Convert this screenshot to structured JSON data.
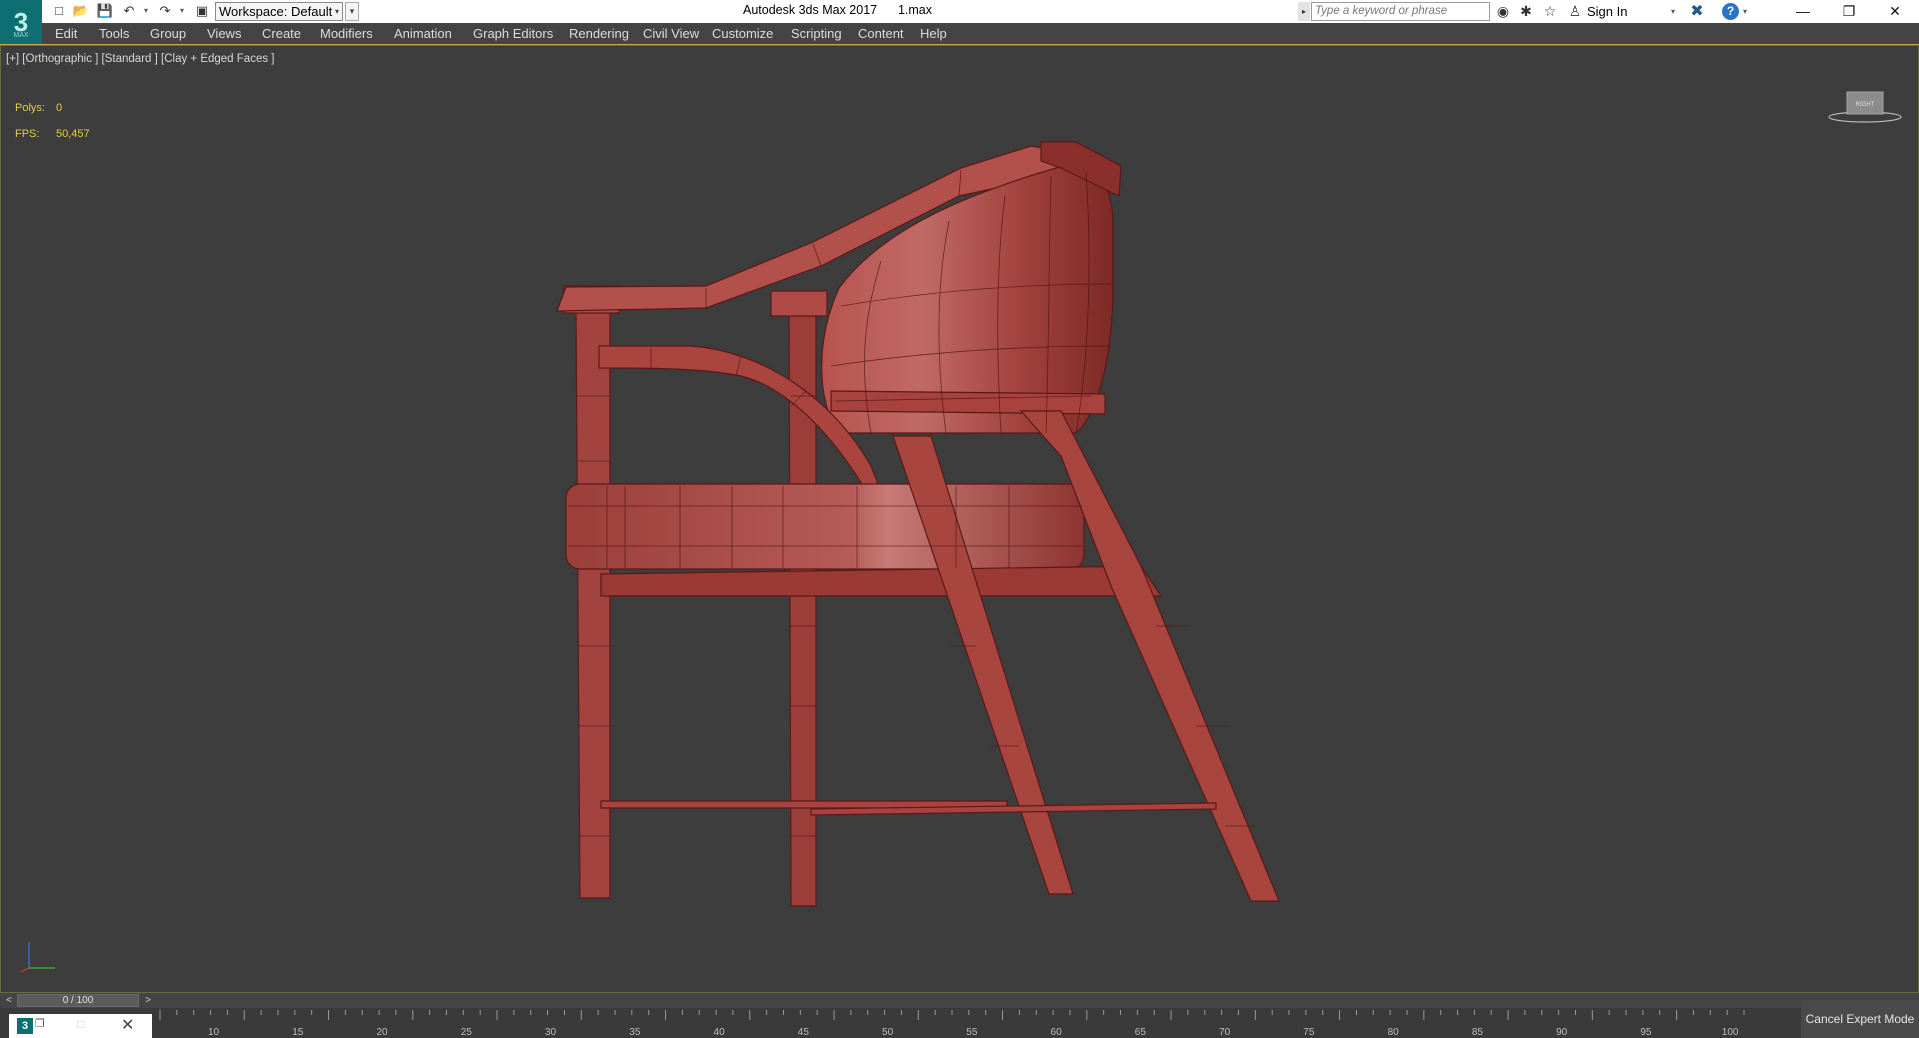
{
  "app": {
    "logo_text": "3",
    "logo_caption": "MAX",
    "window_title": "Autodesk 3ds Max 2017      1.max",
    "workspace_label": "Workspace: Default",
    "search_placeholder": "Type a keyword or phrase",
    "sign_in_label": "Sign In",
    "help_label": "?"
  },
  "menu": [
    "Edit",
    "Tools",
    "Group",
    "Views",
    "Create",
    "Modifiers",
    "Animation",
    "Graph Editors",
    "Rendering",
    "Civil View",
    "Customize",
    "Scripting",
    "Content",
    "Help"
  ],
  "viewport": {
    "label": "[+] [Orthographic ] [Standard ] [Clay + Edged Faces ]",
    "polys_label": "Polys:",
    "polys_value": "0",
    "fps_label": "FPS:",
    "fps_value": "50,457",
    "viewcube_text": "RIGHT",
    "model_color": "#a7423e"
  },
  "timeline": {
    "slider_text": "0 / 100",
    "prev_label": "<",
    "next_label": ">",
    "ticks": [
      "10",
      "15",
      "20",
      "25",
      "30",
      "35",
      "40",
      "45",
      "50",
      "55",
      "60",
      "65",
      "70",
      "75",
      "80",
      "85",
      "90",
      "95",
      "100"
    ]
  },
  "expert_mode_label": "Cancel Expert Mode"
}
